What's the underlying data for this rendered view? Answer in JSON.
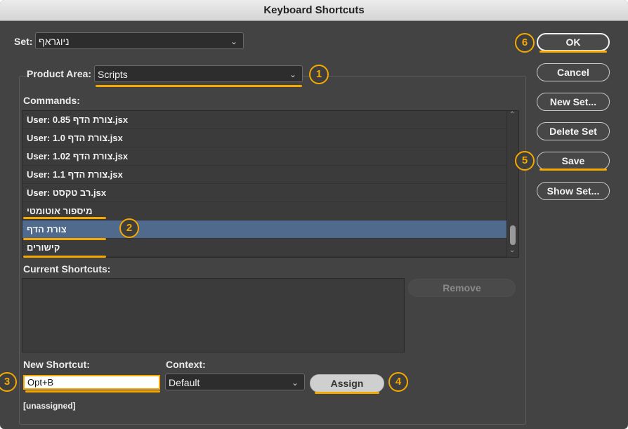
{
  "window": {
    "title": "Keyboard Shortcuts"
  },
  "set": {
    "label": "Set:",
    "value": "ניוגראף"
  },
  "product_area": {
    "label": "Product Area:",
    "value": "Scripts"
  },
  "commands": {
    "label": "Commands:",
    "items": [
      "User: 0.85 צורת הדף.jsx",
      "User: 1.0 צורת הדף.jsx",
      "User: 1.02 צורת הדף.jsx",
      "User: 1.1 צורת הדף.jsx",
      "User: רב טקסט.jsx",
      "מיספור אוטומטי",
      "צורת הדף",
      "קישורים"
    ],
    "selected_index": 6
  },
  "current_shortcuts": {
    "label": "Current Shortcuts:",
    "remove_label": "Remove"
  },
  "new_shortcut": {
    "label": "New Shortcut:",
    "value": "Opt+B",
    "status": "[unassigned]"
  },
  "context": {
    "label": "Context:",
    "value": "Default",
    "assign_label": "Assign"
  },
  "buttons": {
    "ok": "OK",
    "cancel": "Cancel",
    "new_set": "New Set...",
    "delete_set": "Delete Set",
    "save": "Save",
    "show_set": "Show Set..."
  },
  "callouts": [
    "1",
    "2",
    "3",
    "4",
    "5",
    "6"
  ],
  "colors": {
    "accent": "#f5a800",
    "selection": "#4f6a8d",
    "panel": "#434343"
  }
}
